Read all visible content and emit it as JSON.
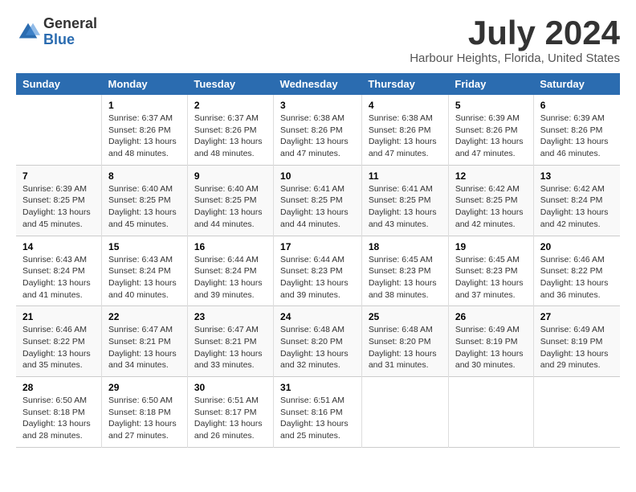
{
  "header": {
    "logo_general": "General",
    "logo_blue": "Blue",
    "month_title": "July 2024",
    "location": "Harbour Heights, Florida, United States"
  },
  "days_of_week": [
    "Sunday",
    "Monday",
    "Tuesday",
    "Wednesday",
    "Thursday",
    "Friday",
    "Saturday"
  ],
  "weeks": [
    [
      {
        "num": "",
        "sunrise": "",
        "sunset": "",
        "daylight": ""
      },
      {
        "num": "1",
        "sunrise": "Sunrise: 6:37 AM",
        "sunset": "Sunset: 8:26 PM",
        "daylight": "Daylight: 13 hours and 48 minutes."
      },
      {
        "num": "2",
        "sunrise": "Sunrise: 6:37 AM",
        "sunset": "Sunset: 8:26 PM",
        "daylight": "Daylight: 13 hours and 48 minutes."
      },
      {
        "num": "3",
        "sunrise": "Sunrise: 6:38 AM",
        "sunset": "Sunset: 8:26 PM",
        "daylight": "Daylight: 13 hours and 47 minutes."
      },
      {
        "num": "4",
        "sunrise": "Sunrise: 6:38 AM",
        "sunset": "Sunset: 8:26 PM",
        "daylight": "Daylight: 13 hours and 47 minutes."
      },
      {
        "num": "5",
        "sunrise": "Sunrise: 6:39 AM",
        "sunset": "Sunset: 8:26 PM",
        "daylight": "Daylight: 13 hours and 47 minutes."
      },
      {
        "num": "6",
        "sunrise": "Sunrise: 6:39 AM",
        "sunset": "Sunset: 8:26 PM",
        "daylight": "Daylight: 13 hours and 46 minutes."
      }
    ],
    [
      {
        "num": "7",
        "sunrise": "Sunrise: 6:39 AM",
        "sunset": "Sunset: 8:25 PM",
        "daylight": "Daylight: 13 hours and 45 minutes."
      },
      {
        "num": "8",
        "sunrise": "Sunrise: 6:40 AM",
        "sunset": "Sunset: 8:25 PM",
        "daylight": "Daylight: 13 hours and 45 minutes."
      },
      {
        "num": "9",
        "sunrise": "Sunrise: 6:40 AM",
        "sunset": "Sunset: 8:25 PM",
        "daylight": "Daylight: 13 hours and 44 minutes."
      },
      {
        "num": "10",
        "sunrise": "Sunrise: 6:41 AM",
        "sunset": "Sunset: 8:25 PM",
        "daylight": "Daylight: 13 hours and 44 minutes."
      },
      {
        "num": "11",
        "sunrise": "Sunrise: 6:41 AM",
        "sunset": "Sunset: 8:25 PM",
        "daylight": "Daylight: 13 hours and 43 minutes."
      },
      {
        "num": "12",
        "sunrise": "Sunrise: 6:42 AM",
        "sunset": "Sunset: 8:25 PM",
        "daylight": "Daylight: 13 hours and 42 minutes."
      },
      {
        "num": "13",
        "sunrise": "Sunrise: 6:42 AM",
        "sunset": "Sunset: 8:24 PM",
        "daylight": "Daylight: 13 hours and 42 minutes."
      }
    ],
    [
      {
        "num": "14",
        "sunrise": "Sunrise: 6:43 AM",
        "sunset": "Sunset: 8:24 PM",
        "daylight": "Daylight: 13 hours and 41 minutes."
      },
      {
        "num": "15",
        "sunrise": "Sunrise: 6:43 AM",
        "sunset": "Sunset: 8:24 PM",
        "daylight": "Daylight: 13 hours and 40 minutes."
      },
      {
        "num": "16",
        "sunrise": "Sunrise: 6:44 AM",
        "sunset": "Sunset: 8:24 PM",
        "daylight": "Daylight: 13 hours and 39 minutes."
      },
      {
        "num": "17",
        "sunrise": "Sunrise: 6:44 AM",
        "sunset": "Sunset: 8:23 PM",
        "daylight": "Daylight: 13 hours and 39 minutes."
      },
      {
        "num": "18",
        "sunrise": "Sunrise: 6:45 AM",
        "sunset": "Sunset: 8:23 PM",
        "daylight": "Daylight: 13 hours and 38 minutes."
      },
      {
        "num": "19",
        "sunrise": "Sunrise: 6:45 AM",
        "sunset": "Sunset: 8:23 PM",
        "daylight": "Daylight: 13 hours and 37 minutes."
      },
      {
        "num": "20",
        "sunrise": "Sunrise: 6:46 AM",
        "sunset": "Sunset: 8:22 PM",
        "daylight": "Daylight: 13 hours and 36 minutes."
      }
    ],
    [
      {
        "num": "21",
        "sunrise": "Sunrise: 6:46 AM",
        "sunset": "Sunset: 8:22 PM",
        "daylight": "Daylight: 13 hours and 35 minutes."
      },
      {
        "num": "22",
        "sunrise": "Sunrise: 6:47 AM",
        "sunset": "Sunset: 8:21 PM",
        "daylight": "Daylight: 13 hours and 34 minutes."
      },
      {
        "num": "23",
        "sunrise": "Sunrise: 6:47 AM",
        "sunset": "Sunset: 8:21 PM",
        "daylight": "Daylight: 13 hours and 33 minutes."
      },
      {
        "num": "24",
        "sunrise": "Sunrise: 6:48 AM",
        "sunset": "Sunset: 8:20 PM",
        "daylight": "Daylight: 13 hours and 32 minutes."
      },
      {
        "num": "25",
        "sunrise": "Sunrise: 6:48 AM",
        "sunset": "Sunset: 8:20 PM",
        "daylight": "Daylight: 13 hours and 31 minutes."
      },
      {
        "num": "26",
        "sunrise": "Sunrise: 6:49 AM",
        "sunset": "Sunset: 8:19 PM",
        "daylight": "Daylight: 13 hours and 30 minutes."
      },
      {
        "num": "27",
        "sunrise": "Sunrise: 6:49 AM",
        "sunset": "Sunset: 8:19 PM",
        "daylight": "Daylight: 13 hours and 29 minutes."
      }
    ],
    [
      {
        "num": "28",
        "sunrise": "Sunrise: 6:50 AM",
        "sunset": "Sunset: 8:18 PM",
        "daylight": "Daylight: 13 hours and 28 minutes."
      },
      {
        "num": "29",
        "sunrise": "Sunrise: 6:50 AM",
        "sunset": "Sunset: 8:18 PM",
        "daylight": "Daylight: 13 hours and 27 minutes."
      },
      {
        "num": "30",
        "sunrise": "Sunrise: 6:51 AM",
        "sunset": "Sunset: 8:17 PM",
        "daylight": "Daylight: 13 hours and 26 minutes."
      },
      {
        "num": "31",
        "sunrise": "Sunrise: 6:51 AM",
        "sunset": "Sunset: 8:16 PM",
        "daylight": "Daylight: 13 hours and 25 minutes."
      },
      {
        "num": "",
        "sunrise": "",
        "sunset": "",
        "daylight": ""
      },
      {
        "num": "",
        "sunrise": "",
        "sunset": "",
        "daylight": ""
      },
      {
        "num": "",
        "sunrise": "",
        "sunset": "",
        "daylight": ""
      }
    ]
  ]
}
